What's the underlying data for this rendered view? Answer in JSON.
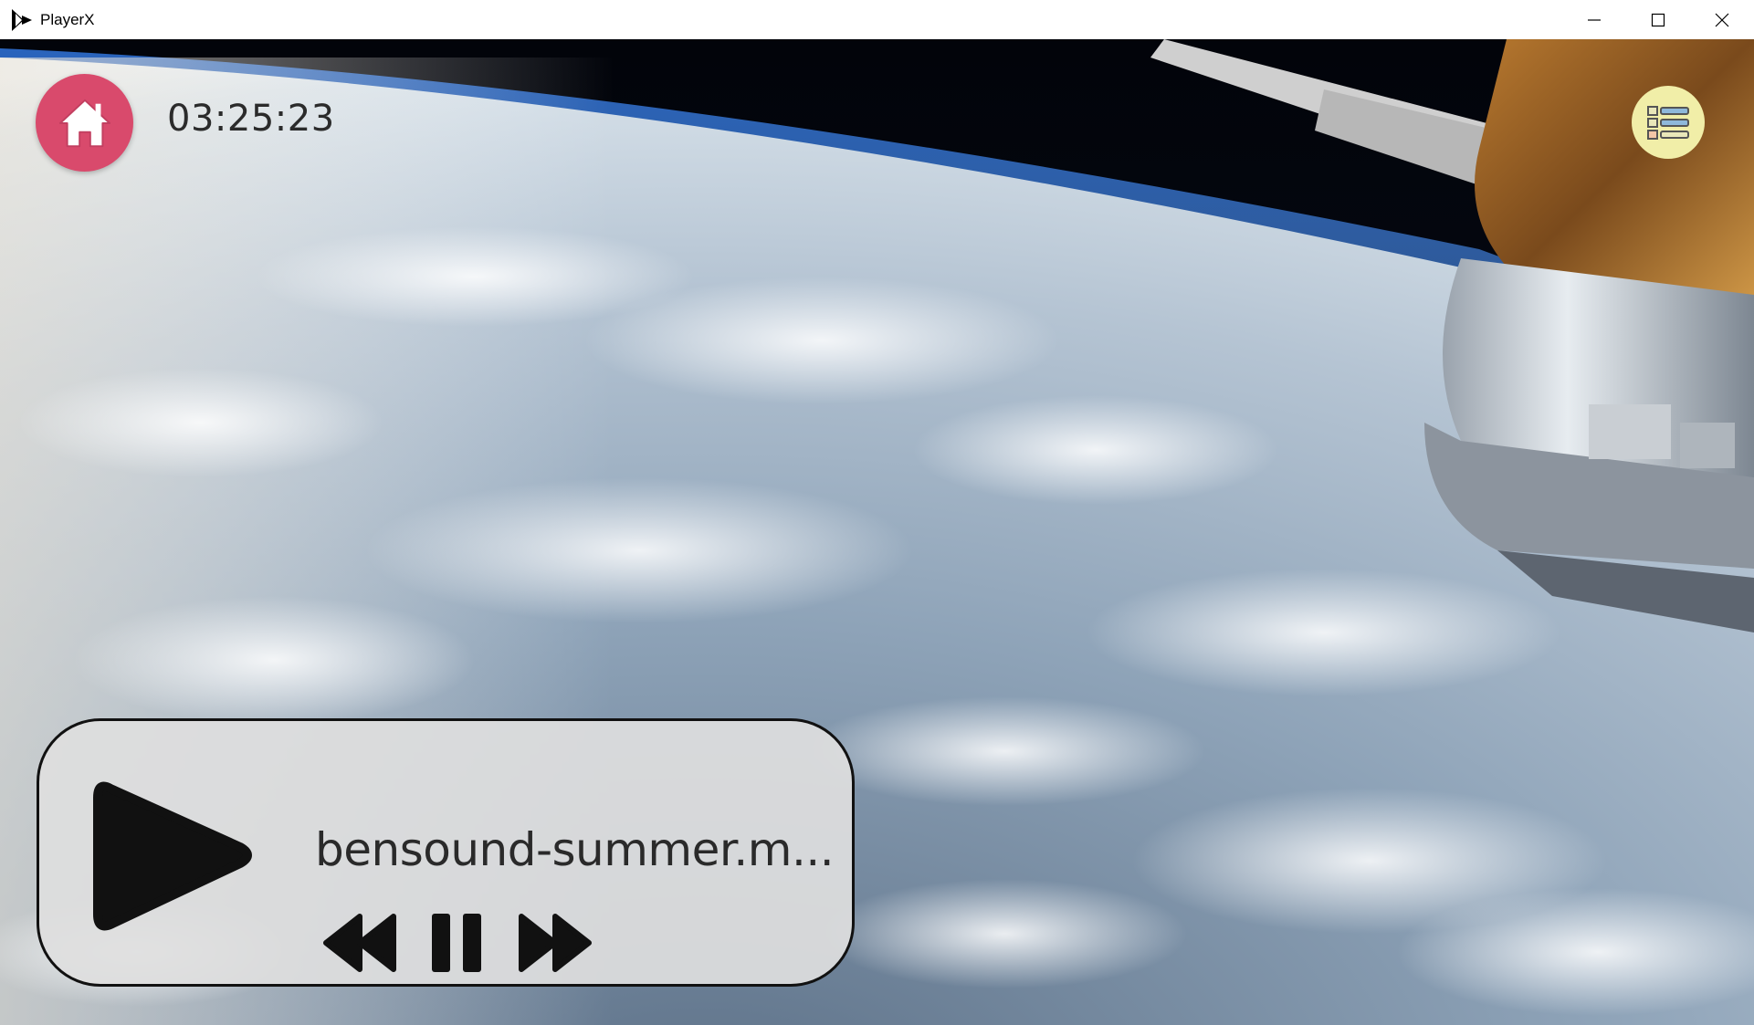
{
  "window": {
    "title": "PlayerX",
    "controls": [
      "minimize-icon",
      "maximize-icon",
      "close-icon"
    ]
  },
  "top_bar": {
    "home_icon": "home-icon",
    "clock": "03:25:23",
    "playlist_icon": "playlist-icon"
  },
  "player": {
    "track_title": "bensound-summer.m...",
    "big_button_icon": "play-icon",
    "controls": [
      "rewind-icon",
      "pause-icon",
      "fast-forward-icon"
    ]
  },
  "colors": {
    "home_button": "#d94a6c",
    "playlist_button": "#f1eea8",
    "panel": "#dedede"
  }
}
